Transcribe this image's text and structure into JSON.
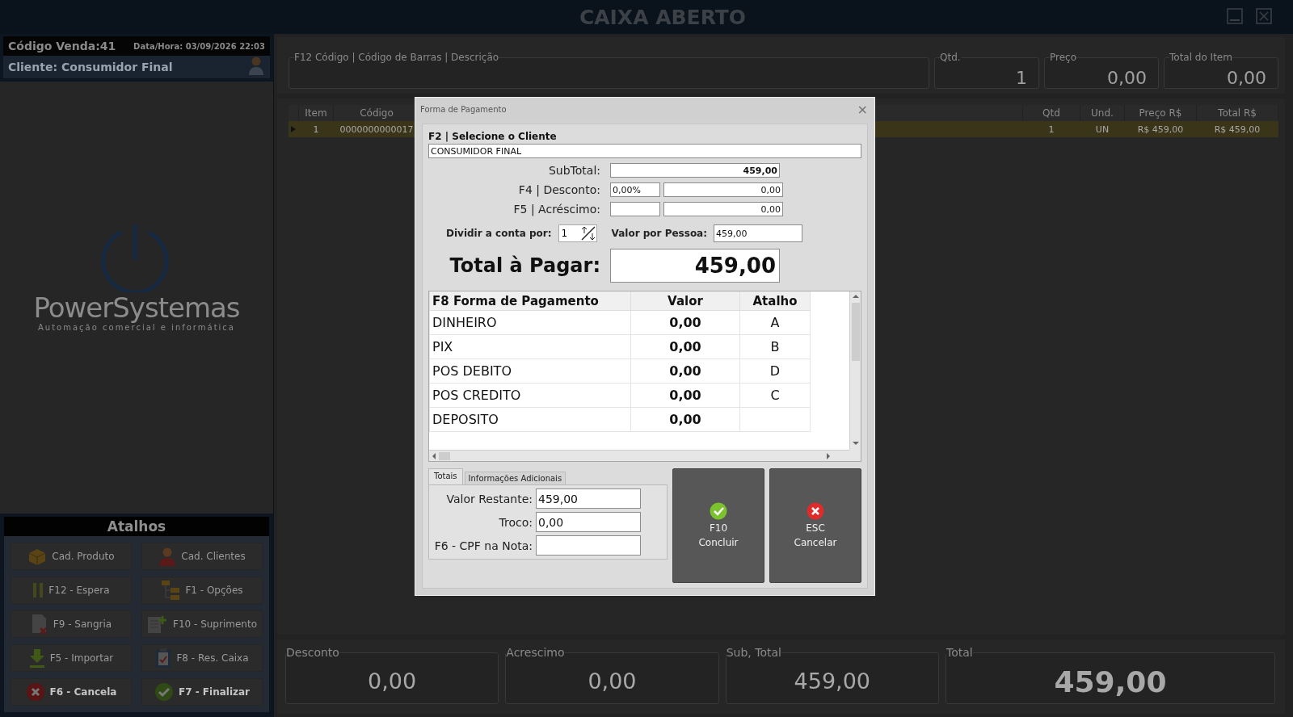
{
  "window": {
    "title": "CAIXA ABERTO"
  },
  "sale": {
    "code": "Código Venda:41",
    "datetime": "Data/Hora: 03/09/2026 22:03",
    "client": "Cliente: Consumidor Final"
  },
  "logo": {
    "name": "PowerSystemas",
    "tagline": "Automação comercial e informática"
  },
  "shortcuts": {
    "title": "Atalhos",
    "buttons": [
      {
        "label": "Cad. Produto",
        "bold": false
      },
      {
        "label": "Cad. Clientes",
        "bold": false
      },
      {
        "label": "F12 - Espera",
        "bold": false
      },
      {
        "label": "F1 - Opções",
        "bold": false
      },
      {
        "label": "F9 - Sangria",
        "bold": false
      },
      {
        "label": "F10 - Suprimento",
        "bold": false
      },
      {
        "label": "F5 - Importar",
        "bold": false
      },
      {
        "label": "F8 - Res. Caixa",
        "bold": false
      },
      {
        "label": "F6 - Cancela",
        "bold": true
      },
      {
        "label": "F7 - Finalizar",
        "bold": true
      }
    ]
  },
  "entry": {
    "search_label": "F12  Código | Código de Barras | Descrição",
    "fields": [
      {
        "label": "Qtd.",
        "value": "1"
      },
      {
        "label": "Preço",
        "value": "0,00"
      },
      {
        "label": "Total do Item",
        "value": "0,00"
      }
    ]
  },
  "grid": {
    "columns": [
      "Item",
      "Código",
      "Qtd",
      "Und.",
      "Preço R$",
      "Total R$"
    ],
    "rows": [
      {
        "cells": [
          "1",
          "0000000000017",
          "1",
          "UN",
          "R$ 459,00",
          "R$ 459,00"
        ],
        "selected": true
      }
    ]
  },
  "totals": [
    {
      "label": "Desconto",
      "value": "0,00",
      "kind": "plain"
    },
    {
      "label": "Acrescimo",
      "value": "0,00",
      "kind": "plain"
    },
    {
      "label": "Sub, Total",
      "value": "459,00",
      "kind": "plain"
    },
    {
      "label": "Total",
      "value": "459,00",
      "kind": "grand"
    }
  ],
  "dialog": {
    "title": "Forma de Pagamento",
    "close": "×",
    "client_label": "F2 | Selecione o Cliente",
    "client_value": "CONSUMIDOR FINAL",
    "subtotal_label": "SubTotal:",
    "subtotal_value": "459,00",
    "discount_label": "F4 | Desconto:",
    "discount_percent": "0,00%",
    "discount_value": "0,00",
    "surcharge_label": "F5 | Acréscimo:",
    "surcharge_value": "0,00",
    "split_label": "Dividir a conta por:",
    "split_value": "1",
    "per_person_label": "Valor por Pessoa:",
    "per_person_value": "459,00",
    "total_label": "Total à Pagar:",
    "total_value": "459,00",
    "payments": {
      "columns": [
        "F8 Forma de Pagamento",
        "Valor",
        "Atalho"
      ],
      "rows": [
        {
          "name": "DINHEIRO",
          "value": "0,00",
          "shortcut": "A"
        },
        {
          "name": "PIX",
          "value": "0,00",
          "shortcut": "B"
        },
        {
          "name": "POS DEBITO",
          "value": "0,00",
          "shortcut": "D"
        },
        {
          "name": "POS CREDITO",
          "value": "0,00",
          "shortcut": "C"
        },
        {
          "name": "DEPOSITO",
          "value": "0,00"
        }
      ]
    },
    "tabs": [
      {
        "label": "Totais",
        "selected": true
      },
      {
        "label": "Informações Adicionais",
        "selected": false
      }
    ],
    "fields": [
      {
        "label": "Valor Restante:",
        "value": "459,00"
      },
      {
        "label": "Troco:",
        "value": "0,00"
      },
      {
        "label": "F6 - CPF na Nota:"
      }
    ],
    "buttons": [
      {
        "key": "F10",
        "label": "Concluir",
        "kind": "confirm"
      },
      {
        "key": "ESC",
        "label": "Cancelar",
        "kind": "cancel"
      }
    ]
  }
}
